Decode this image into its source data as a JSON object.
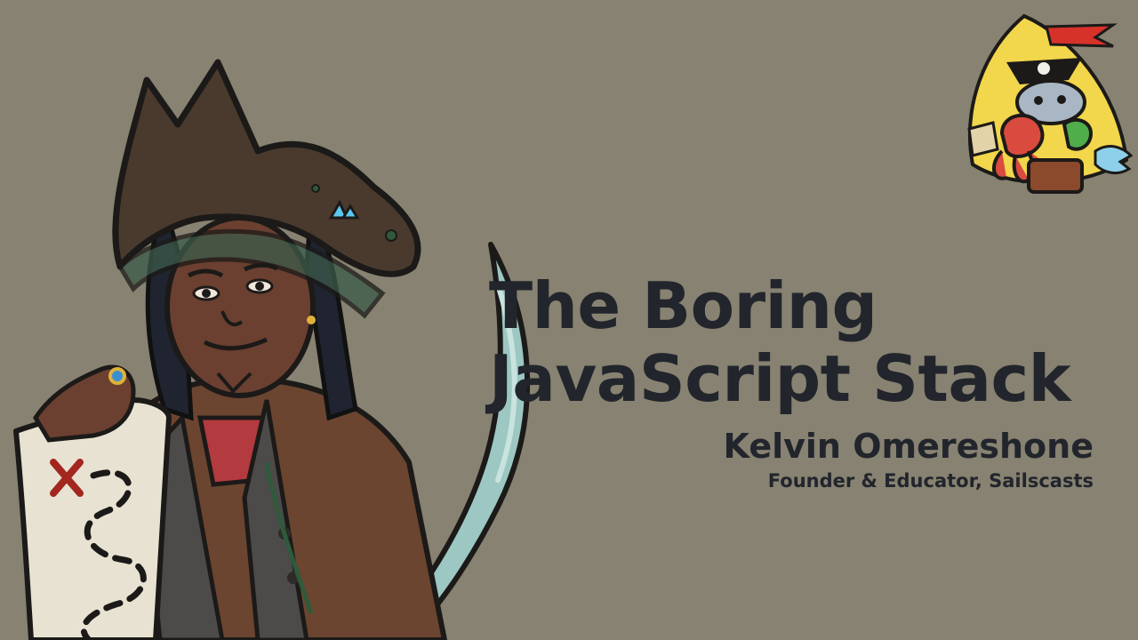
{
  "slide": {
    "title_lines": [
      "The Boring",
      "JavaScript Stack"
    ],
    "speaker": {
      "name": "Kelvin Omereshone",
      "role": "Founder & Educator, Sailscasts"
    }
  },
  "colors": {
    "background": "#878271",
    "text": "#22252c",
    "hat": "#4a3a2e",
    "coat": "#6b4530",
    "blade": "#9cc7c2",
    "logo_flag": "#f2d64b"
  },
  "illustrations": {
    "left": "pirate-captain-holding-treasure-map-and-cutlass",
    "top_right": "pirate-crew-mascot-logo"
  }
}
